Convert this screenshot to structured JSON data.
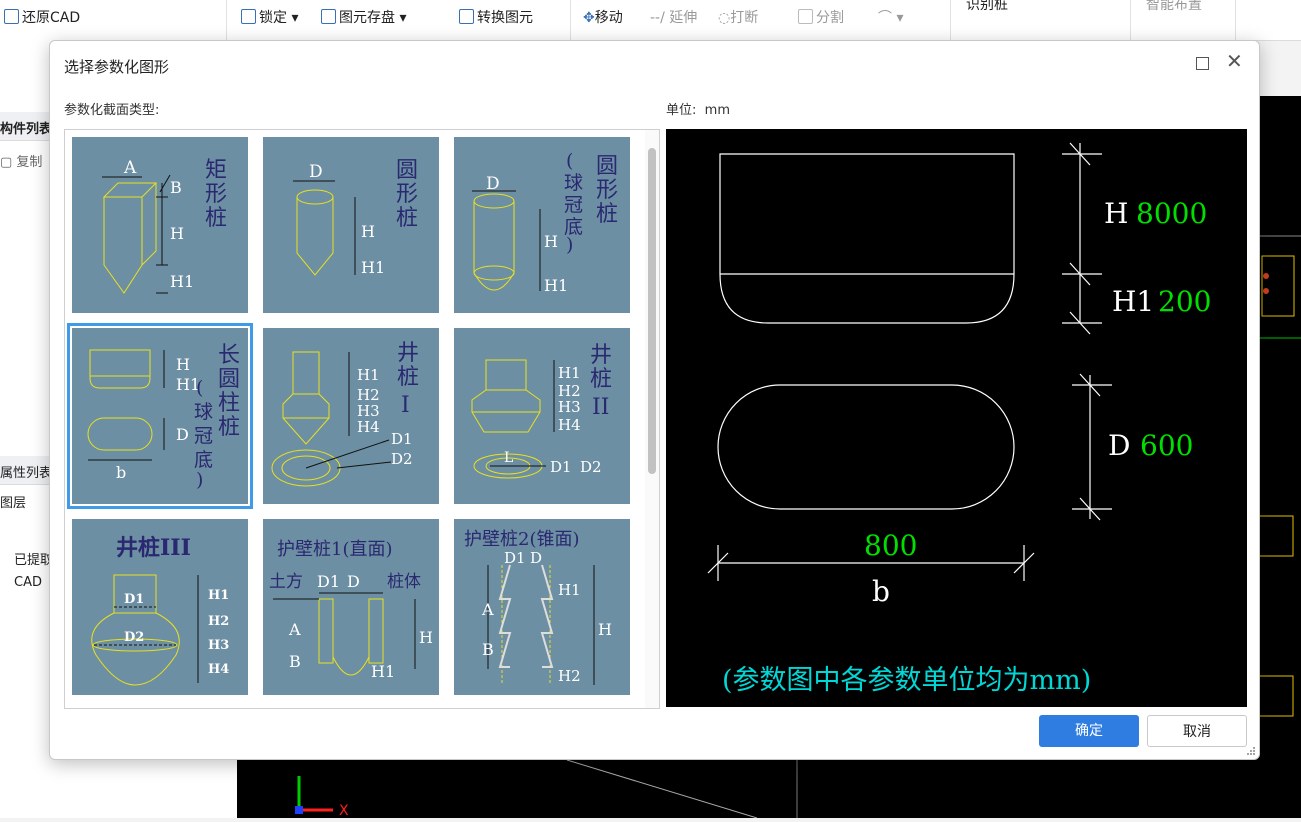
{
  "toolbar": {
    "restore_cad": "还原CAD",
    "lock": "锁定",
    "save_element": "图元存盘",
    "convert_element": "转换图元",
    "move": "移动",
    "extend": "延伸",
    "break": "打断",
    "split": "分割",
    "identify_pile": "识别桩",
    "smart_layout": "智能布置"
  },
  "left_panel": {
    "component_list": "构件列表",
    "copy": "复制",
    "property_list": "属性列表",
    "layer": "图层",
    "row1": "已提取",
    "row2": "CAD"
  },
  "dialog": {
    "title": "选择参数化图形",
    "section_label": "参数化截面类型:",
    "unit_label": "单位:",
    "unit_value": "mm",
    "ok": "确定",
    "cancel": "取消"
  },
  "tiles": [
    {
      "name": "矩形桩",
      "labels": [
        "A",
        "B",
        "H",
        "H1"
      ]
    },
    {
      "name": "圆形桩",
      "labels": [
        "D",
        "H",
        "H1"
      ]
    },
    {
      "name": "圆形桩(球冠底)",
      "labels": [
        "D",
        "H",
        "H1"
      ]
    },
    {
      "name": "长圆柱桩(球冠底)",
      "labels": [
        "H",
        "H1",
        "D",
        "b"
      ],
      "selected": true
    },
    {
      "name": "井桩I",
      "labels": [
        "H1",
        "H2",
        "H3",
        "H4",
        "D1",
        "D2"
      ]
    },
    {
      "name": "井桩II",
      "labels": [
        "H1",
        "H2",
        "H3",
        "H4",
        "L",
        "D1",
        "D2"
      ]
    },
    {
      "name": "井桩III",
      "labels": [
        "D1",
        "D2",
        "H1",
        "H2",
        "H3",
        "H4"
      ]
    },
    {
      "name": "护壁桩1(直面)",
      "labels": [
        "土方",
        "D1",
        "D",
        "桩体",
        "A",
        "B",
        "H",
        "H1"
      ]
    },
    {
      "name": "护壁桩2(锥面)",
      "labels": [
        "D1",
        "D",
        "A",
        "B",
        "H1",
        "H",
        "H2"
      ]
    }
  ],
  "preview": {
    "H_label": "H",
    "H_value": "8000",
    "H1_label": "H1",
    "H1_value": "200",
    "D_label": "D",
    "D_value": "600",
    "b_value": "800",
    "b_label": "b",
    "note": "(参数图中各参数单位均为mm)"
  },
  "colors": {
    "accent": "#2f7de1",
    "tile_bg": "#6d8fa3",
    "value_green": "#00e000",
    "note_cyan": "#00d8d8"
  }
}
